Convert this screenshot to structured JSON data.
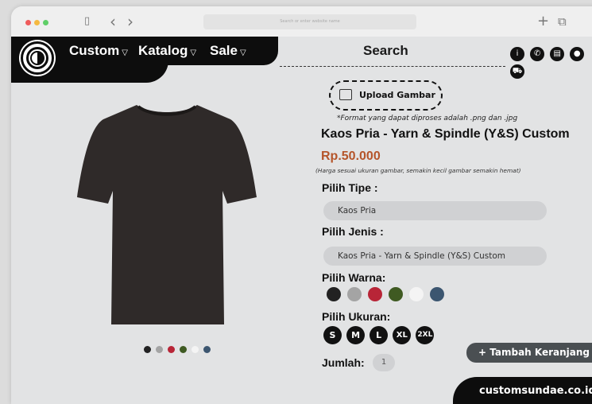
{
  "browser": {
    "url_placeholder": "Search or enter website name",
    "new_tab_glyph": "+",
    "copy_glyph": "⧉",
    "sidebar_glyph": "▯",
    "back_glyph": "‹",
    "forward_glyph": "›",
    "traffic_lights": [
      "#ef5b5b",
      "#f5b941",
      "#5fcf68"
    ]
  },
  "nav": {
    "items": [
      "Custom",
      "Katalog",
      "Sale"
    ],
    "search_label": "Search"
  },
  "header_icons": [
    "info-icon",
    "whatsapp-icon",
    "order-icon",
    "user-icon",
    "cart-icon"
  ],
  "upload": {
    "label": "Upload Gambar",
    "note": "*Format yang dapat diproses adalah .png dan .jpg"
  },
  "product": {
    "title": "Kaos Pria - Yarn & Spindle (Y&S) Custom",
    "price": "Rp.50.000",
    "price_note": "(Harga sesuai ukuran gambar, semakin kecil gambar semakin hemat)"
  },
  "type": {
    "label": "Pilih Tipe :",
    "value": "Kaos Pria"
  },
  "kind": {
    "label": "Pilih Jenis :",
    "value": "Kaos Pria - Yarn & Spindle (Y&S) Custom"
  },
  "colors": {
    "label": "Pilih Warna:",
    "swatches": [
      "#222222",
      "#a4a4a4",
      "#b82537",
      "#3f5a22",
      "#f4f4f4",
      "#3c5670"
    ]
  },
  "sizes": {
    "label": "Pilih Ukuran:",
    "options": [
      "S",
      "M",
      "L",
      "XL",
      "2XL"
    ]
  },
  "quantity": {
    "label": "Jumlah:",
    "value": "1"
  },
  "cart_button": "+ Tambah Keranjang",
  "footer_text": "customsundae.co.id",
  "shirt_color": "#2f2a29",
  "thumbnails": [
    "#222222",
    "#a4a4a4",
    "#b82537",
    "#3f5a22",
    "#f4f4f4",
    "#3c5670"
  ]
}
